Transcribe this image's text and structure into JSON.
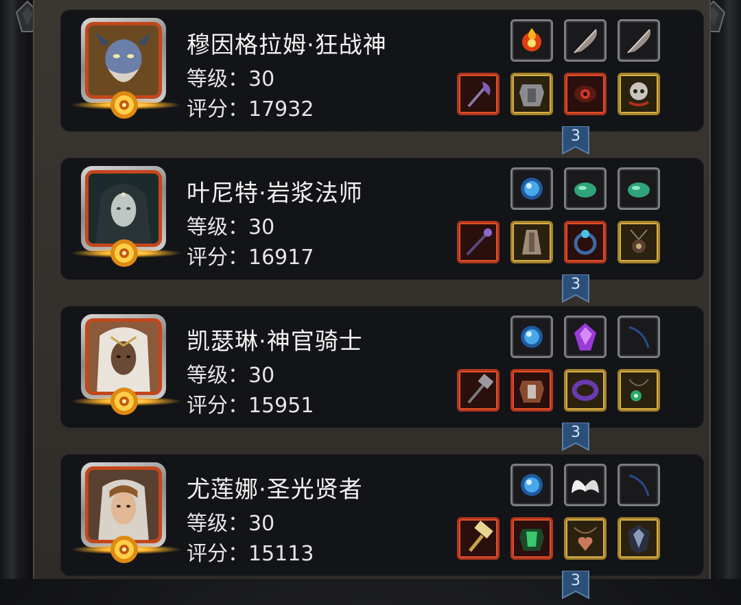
{
  "heroes": [
    {
      "name": "穆因格拉姆·狂战神",
      "level_label": "等级：30",
      "score_label": "评分：17932",
      "portrait_icon": "demon-warrior-portrait-icon",
      "top_items": [
        "fire-orb-icon",
        "feather-quill-icon",
        "feather-quill-icon"
      ],
      "bottom_items": [
        "axe-weapon-icon",
        "plate-armor-icon",
        "red-eye-ring-icon",
        "skull-amulet-icon"
      ],
      "bottom_rarity": [
        "red",
        "gold",
        "red",
        "gold"
      ]
    },
    {
      "name": "叶尼特·岩浆法师",
      "level_label": "等级：30",
      "score_label": "评分：16917",
      "portrait_icon": "hooded-mage-portrait-icon",
      "top_items": [
        "blue-orb-icon",
        "jade-stone-icon",
        "jade-stone-icon"
      ],
      "bottom_items": [
        "staff-weapon-icon",
        "robe-armor-icon",
        "blue-gem-ring-icon",
        "eye-amulet-icon"
      ],
      "bottom_rarity": [
        "red",
        "gold",
        "red",
        "gold"
      ]
    },
    {
      "name": "凯瑟琳·神官骑士",
      "level_label": "等级：30",
      "score_label": "评分：15951",
      "portrait_icon": "priest-knight-portrait-icon",
      "top_items": [
        "blue-orb-icon",
        "purple-crystal-icon",
        "dark-thread-icon"
      ],
      "bottom_items": [
        "warhammer-weapon-icon",
        "red-plate-armor-icon",
        "purple-ring-icon",
        "green-pendant-icon"
      ],
      "bottom_rarity": [
        "red",
        "red",
        "gold",
        "gold"
      ]
    },
    {
      "name": "尤莲娜·圣光贤者",
      "level_label": "等级：30",
      "score_label": "评分：15113",
      "portrait_icon": "holy-sage-portrait-icon",
      "top_items": [
        "blue-orb-icon",
        "white-wings-icon",
        "dark-thread-icon"
      ],
      "bottom_items": [
        "golden-hammer-icon",
        "green-armor-icon",
        "heart-necklace-icon",
        "dark-crest-icon"
      ],
      "bottom_rarity": [
        "red",
        "red",
        "gold",
        "gold"
      ]
    }
  ],
  "connectors": [
    "3",
    "3",
    "3",
    "3"
  ],
  "colors": {
    "panel_bg": "#131417",
    "portrait_border": "#c3471b",
    "red_rarity": "#b1361d",
    "gold_rarity": "#a5822a",
    "grey_slot": "#7d7e80",
    "connector": "#2c4f7a"
  }
}
